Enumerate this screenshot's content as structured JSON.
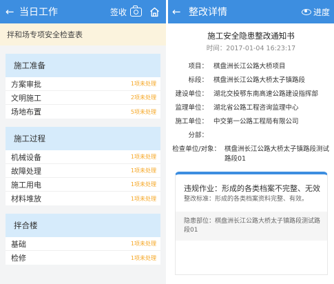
{
  "left": {
    "header": {
      "back_glyph": "←",
      "title": "当日工作",
      "sign_label": "签收"
    },
    "banner": "拌和场专项安全检查表",
    "sections": [
      {
        "title": "施工准备",
        "items": [
          {
            "label": "方案审批",
            "status": "1项未处理"
          },
          {
            "label": "文明施工",
            "status": "2项未处理"
          },
          {
            "label": "场地布置",
            "status": "5项未处理"
          }
        ]
      },
      {
        "title": "施工过程",
        "items": [
          {
            "label": "机械设备",
            "status": "1项未处理"
          },
          {
            "label": "故障处理",
            "status": "1项未处理"
          },
          {
            "label": "施工用电",
            "status": "1项未处理"
          },
          {
            "label": "材料堆放",
            "status": "1项未处理"
          }
        ]
      },
      {
        "title": "拌合楼",
        "items": [
          {
            "label": "基础",
            "status": "1项未处理"
          },
          {
            "label": "检修",
            "status": "1项未处理"
          }
        ]
      }
    ]
  },
  "right": {
    "header": {
      "back_glyph": "←",
      "title": "整改详情",
      "progress_label": "进度"
    },
    "doc_title": "施工安全隐患整改通知书",
    "doc_time": "时间：2017-01-04 16:23:17",
    "fields": [
      {
        "key": "项目：",
        "value": "棋盘洲长江公路大桥项目"
      },
      {
        "key": "标段：",
        "value": "棋盘洲长江公路大桥太子镇路段"
      },
      {
        "key": "建设单位：",
        "value": "湖北交投鄂东南高速公路建设指挥部"
      },
      {
        "key": "监理单位：",
        "value": "湖北省公路工程咨询监理中心"
      },
      {
        "key": "施工单位：",
        "value": "中交第一公路工程局有限公司"
      },
      {
        "key": "分部：",
        "value": ""
      },
      {
        "key": "检查单位/对象：",
        "value": "棋盘洲长江公路大桥太子镇路段测试路段01"
      }
    ],
    "issue": {
      "title": "违规作业：形成的各类档案不完整、无效",
      "standard": "整改标准：形成的各类档案资料完整、有效。",
      "location": "隐患部位：棋盘洲长江公路大桥太子镇路段测试路段01"
    }
  },
  "colors": {
    "header_bg": "#3d8ee0",
    "section_head_bg": "#d6ebfb",
    "banner_bg": "#fbf3dd",
    "status_text": "#f5a623"
  },
  "icons": [
    "back-arrow-icon",
    "camera-icon",
    "home-icon",
    "eye-icon"
  ]
}
